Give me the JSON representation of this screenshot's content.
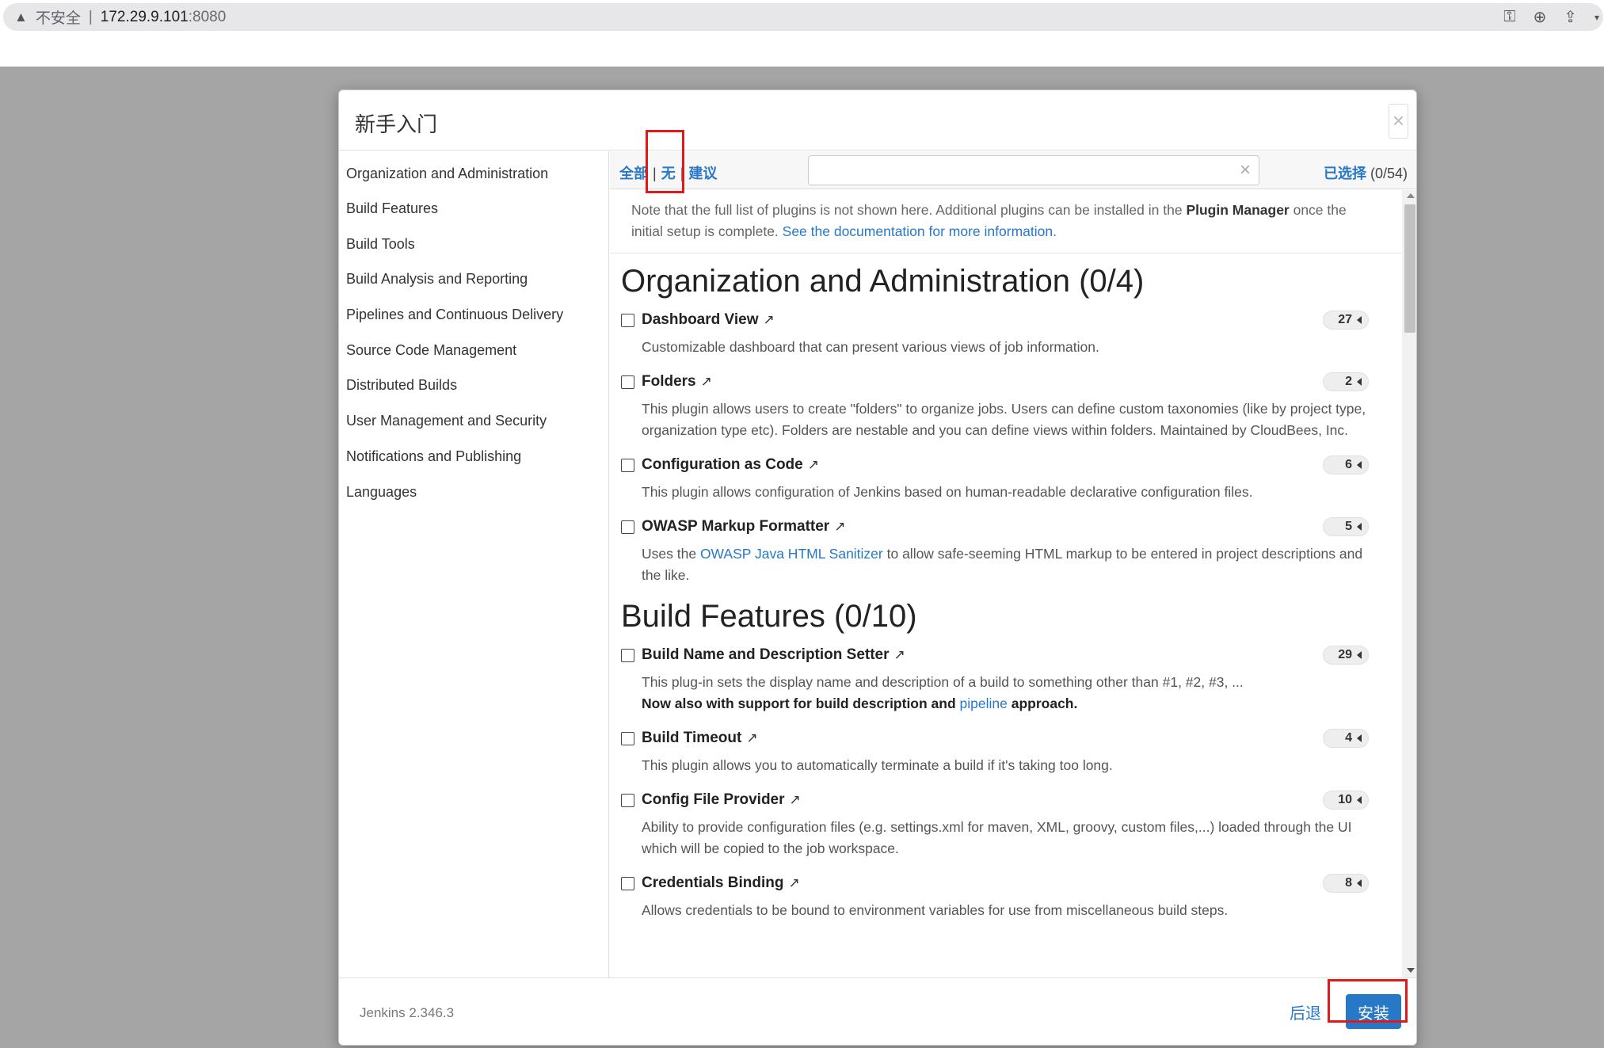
{
  "browser": {
    "insecure_label": "不安全",
    "separator": "|",
    "host": "172.29.9.101",
    "port": ":8080"
  },
  "modal": {
    "title": "新手入门",
    "close": "×"
  },
  "sidebar": {
    "items": [
      {
        "label": "Organization and Administration"
      },
      {
        "label": "Build Features"
      },
      {
        "label": "Build Tools"
      },
      {
        "label": "Build Analysis and Reporting"
      },
      {
        "label": "Pipelines and Continuous Delivery"
      },
      {
        "label": "Source Code Management"
      },
      {
        "label": "Distributed Builds"
      },
      {
        "label": "User Management and Security"
      },
      {
        "label": "Notifications and Publishing"
      },
      {
        "label": "Languages"
      }
    ]
  },
  "toolbar": {
    "filter_all": "全部",
    "filter_none": "无",
    "filter_suggested": "建议",
    "pipe": "|",
    "search_value": "",
    "search_clear": "×",
    "selected_label": "已选择",
    "selected_count": "(0/54)"
  },
  "note": {
    "text1": "Note that the full list of plugins is not shown here. Additional plugins can be installed in the ",
    "bold": "Plugin Manager",
    "text2": " once the initial setup is complete. ",
    "link": "See the documentation for more information."
  },
  "categories": [
    {
      "title": "Organization and Administration (0/4)",
      "plugins": [
        {
          "name": "Dashboard View",
          "deps": "27",
          "desc": "Customizable dashboard that can present various views of job information."
        },
        {
          "name": "Folders",
          "deps": "2",
          "desc": "This plugin allows users to create \"folders\" to organize jobs. Users can define custom taxonomies (like by project type, organization type etc). Folders are nestable and you can define views within folders. Maintained by CloudBees, Inc."
        },
        {
          "name": "Configuration as Code",
          "deps": "6",
          "desc": "This plugin allows configuration of Jenkins based on human-readable declarative configuration files."
        },
        {
          "name": "OWASP Markup Formatter",
          "deps": "5",
          "desc_pre": "Uses the ",
          "desc_link": "OWASP Java HTML Sanitizer",
          "desc_post": " to allow safe-seeming HTML markup to be entered in project descriptions and the like."
        }
      ]
    },
    {
      "title": "Build Features (0/10)",
      "plugins": [
        {
          "name": "Build Name and Description Setter",
          "deps": "29",
          "desc": "This plug-in sets the display name and description of a build to something other than #1, #2, #3, ...",
          "desc_bold_pre": "Now also with support for build description and ",
          "desc_link": "pipeline",
          "desc_bold_post": " approach."
        },
        {
          "name": "Build Timeout",
          "deps": "4",
          "desc": "This plugin allows you to automatically terminate a build if it's taking too long."
        },
        {
          "name": "Config File Provider",
          "deps": "10",
          "desc": "Ability to provide configuration files (e.g. settings.xml for maven, XML, groovy, custom files,...) loaded through the UI which will be copied to the job workspace."
        },
        {
          "name": "Credentials Binding",
          "deps": "8",
          "desc": "Allows credentials to be bound to environment variables for use from miscellaneous build steps."
        }
      ]
    }
  ],
  "footer": {
    "version": "Jenkins 2.346.3",
    "back": "后退",
    "install": "安装"
  },
  "colors": {
    "link": "#2778c7",
    "overlay": "#a5a5a5",
    "annotation": "#e0191b"
  }
}
